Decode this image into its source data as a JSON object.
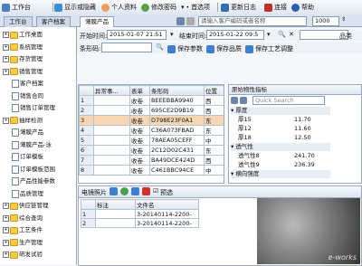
{
  "toolbar": {
    "workbench": "工作台",
    "show_hidden": "显示或隐藏",
    "personal_info": "个人资料",
    "change_password": "修改密码",
    "preferences": "首选项",
    "update_log": "更新日志",
    "connect": "连接",
    "help": "帮助",
    "customer_search_placeholder": "请输入客户编码或者名称",
    "count_value": "1000"
  },
  "tabs": [
    "工作台",
    "客户档案",
    "薄膜产品"
  ],
  "sidebar": {
    "items": [
      {
        "label": "工作桌面",
        "type": "folder",
        "indent": 0
      },
      {
        "label": "系统管理",
        "type": "folder",
        "indent": 0
      },
      {
        "label": "存货管理",
        "type": "folder",
        "indent": 0
      },
      {
        "label": "销售管理",
        "type": "folder",
        "indent": 0
      },
      {
        "label": "客户档案",
        "type": "doc",
        "indent": 1
      },
      {
        "label": "销售合同",
        "type": "doc",
        "indent": 1
      },
      {
        "label": "销售订单管理",
        "type": "doc",
        "indent": 1
      },
      {
        "label": "抽样检测",
        "type": "folder",
        "indent": 0
      },
      {
        "label": "薄膜产品",
        "type": "doc",
        "indent": 1
      },
      {
        "label": "薄膜产品-泳",
        "type": "doc",
        "indent": 1
      },
      {
        "label": "订单模板",
        "type": "doc",
        "indent": 1
      },
      {
        "label": "订单模板范围",
        "type": "doc",
        "indent": 1
      },
      {
        "label": "产品性能参数",
        "type": "doc",
        "indent": 1
      },
      {
        "label": "品质管理",
        "type": "doc",
        "indent": 1
      },
      {
        "label": "供应链管理",
        "type": "folder",
        "indent": 0
      },
      {
        "label": "综合查询",
        "type": "folder",
        "indent": 0
      },
      {
        "label": "工艺条件",
        "type": "folder",
        "indent": 0
      },
      {
        "label": "生产管理",
        "type": "folder",
        "indent": 0
      },
      {
        "label": "研发试验",
        "type": "folder",
        "indent": 0
      }
    ]
  },
  "filter": {
    "start_time_label": "开始时间:",
    "start_time_value": "2015-01-07 21:51",
    "end_time_label": "结束时间:",
    "end_time_value": "2015-01-22 09:5",
    "product_label": "品类",
    "barcode_label": "条形码:",
    "save_params": "保存参数",
    "save_product": "保存品质",
    "save_process": "保存工艺调整"
  },
  "main_table": {
    "headers": [
      "",
      "异常事...",
      "表单",
      "条形码",
      "位置"
    ],
    "rows": [
      [
        "1",
        "",
        "收卷",
        "BEEEBBA9940",
        "西"
      ],
      [
        "2",
        "",
        "收卷",
        "695CE2D9B19",
        "西"
      ],
      [
        "3",
        "",
        "收卷",
        "D798E23F0A1",
        "东"
      ],
      [
        "4",
        "",
        "收卷",
        "C36A073FBAD",
        "东"
      ],
      [
        "5",
        "",
        "收卷",
        "78AEA05CEFF",
        "中"
      ],
      [
        "6",
        "",
        "收卷",
        "2C12D02C431",
        "东"
      ],
      [
        "7",
        "",
        "收卷",
        "BA49DCE424D",
        "西"
      ],
      [
        "8",
        "",
        "收卷",
        "C461BBC94CE",
        "中"
      ]
    ],
    "selected_row": 2
  },
  "properties": {
    "title": "原始物性指标",
    "search_placeholder": "Quick Search",
    "sections": [
      {
        "name": "厚度",
        "rows": [
          [
            "厚15",
            "11.70"
          ],
          [
            "厚12",
            "11.60"
          ],
          [
            "厚18",
            "12.50"
          ]
        ]
      },
      {
        "name": "透气性",
        "rows": [
          [
            "透气性8",
            "241.70"
          ],
          [
            "透气性9",
            "236.39"
          ]
        ]
      },
      {
        "name": "横向强度",
        "rows": []
      }
    ]
  },
  "photos": {
    "title": "电镜照片",
    "preview_label": "预选",
    "headers": [
      "",
      "标注",
      "文件名"
    ],
    "rows": [
      [
        "1",
        "",
        "3-20140114-2200-"
      ],
      [
        "2",
        "",
        "3-20140114-2200-"
      ]
    ],
    "watermark": "e-works"
  }
}
